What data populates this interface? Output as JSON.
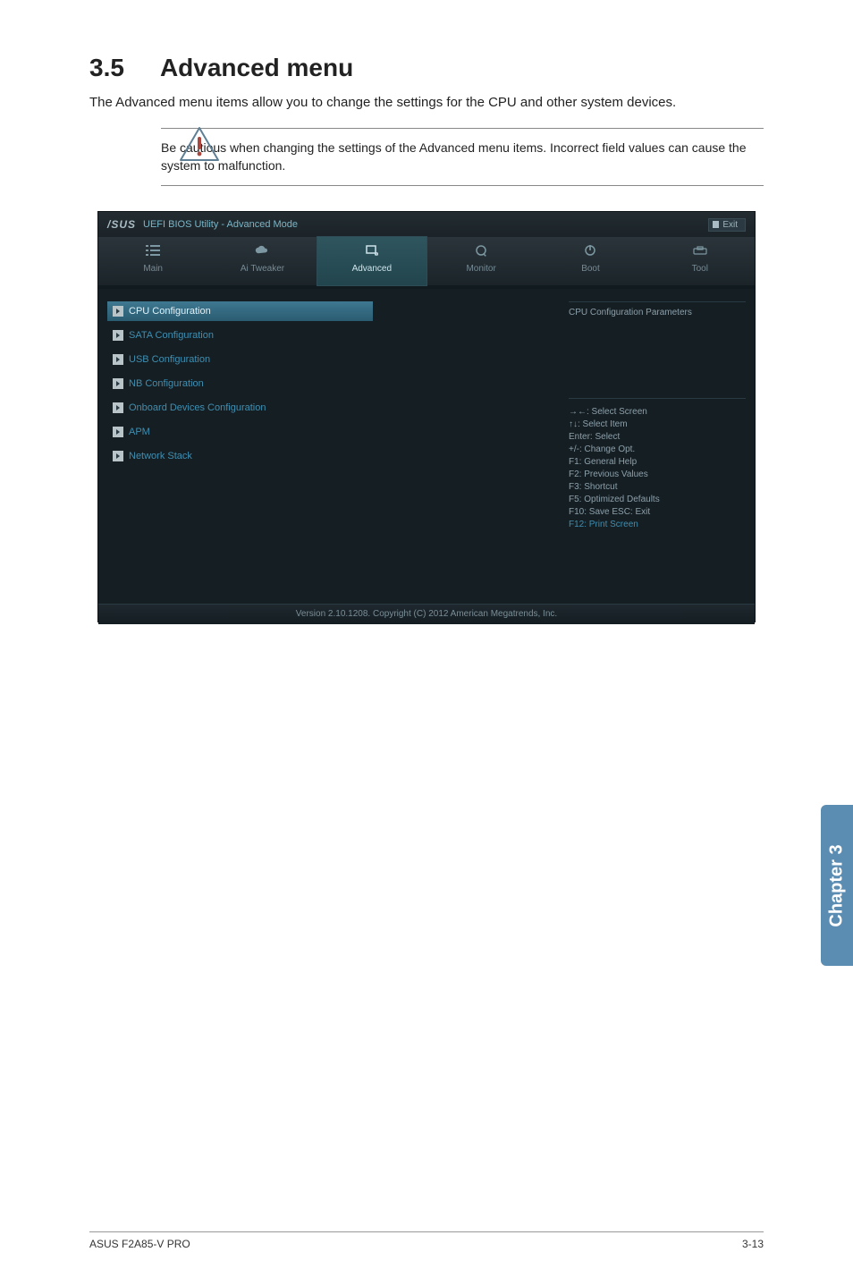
{
  "section": {
    "number": "3.5",
    "title": "Advanced menu"
  },
  "lead": "The Advanced menu items allow you to change the settings for the CPU and other system devices.",
  "note": "Be cautious when changing the settings of the Advanced menu items. Incorrect field values can cause the system to malfunction.",
  "bios": {
    "brand": "/SUS",
    "header_title": "UEFI BIOS Utility - Advanced Mode",
    "exit_label": "Exit",
    "tabs": [
      {
        "label": "Main"
      },
      {
        "label": "Ai  Tweaker"
      },
      {
        "label": "Advanced"
      },
      {
        "label": "Monitor"
      },
      {
        "label": "Boot"
      },
      {
        "label": "Tool"
      }
    ],
    "menu": [
      {
        "label": "CPU Configuration"
      },
      {
        "label": "SATA Configuration"
      },
      {
        "label": "USB Configuration"
      },
      {
        "label": "NB Configuration"
      },
      {
        "label": "Onboard Devices Configuration"
      },
      {
        "label": "APM"
      },
      {
        "label": "Network Stack"
      }
    ],
    "right_title": "CPU Configuration Parameters",
    "help": [
      "→←:  Select  Screen",
      "↑↓:  Select  Item",
      "Enter:  Select",
      "+/-:  Change  Opt.",
      "F1:  General  Help",
      "F2:  Previous  Values",
      "F3:  Shortcut",
      "F5:  Optimized  Defaults",
      "F10:  Save    ESC:  Exit",
      "F12: Print Screen"
    ],
    "footer": "Version  2.10.1208.   Copyright  (C)  2012  American  Megatrends,  Inc."
  },
  "chapter_tab": "Chapter 3",
  "footer_left": "ASUS F2A85-V PRO",
  "footer_right": "3-13"
}
